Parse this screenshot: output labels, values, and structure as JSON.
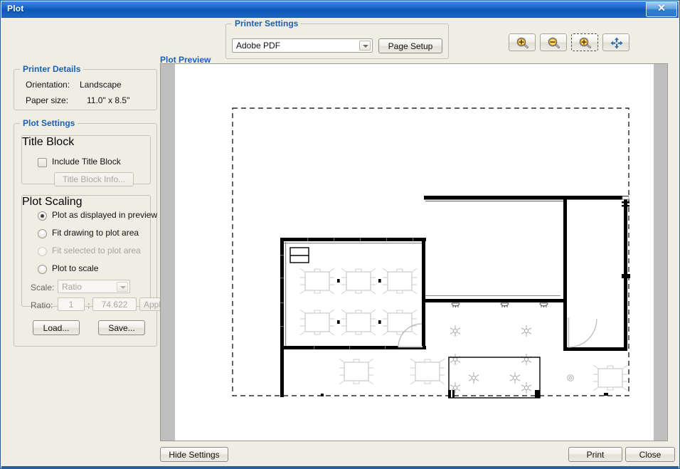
{
  "window": {
    "title": "Plot",
    "close_icon": "close-icon",
    "close_glyph": "✕",
    "accent_color": "#1b5fb4",
    "titlebar_color": "#1665c8",
    "face_color": "#efedE4"
  },
  "printer_details": {
    "legend": "Printer Details",
    "orientation_label": "Orientation:",
    "orientation_value": "Landscape",
    "paper_size_label": "Paper size:",
    "paper_size_value": "11.0\" x 8.5\""
  },
  "plot_settings": {
    "legend": "Plot Settings",
    "title_block": {
      "legend": "Title Block",
      "include_checkbox_label": "Include Title Block",
      "include_checked": false,
      "info_button_label": "Title Block Info...",
      "info_button_enabled": false
    },
    "plot_scaling": {
      "legend": "Plot Scaling",
      "options": [
        {
          "label": "Plot as displayed in preview",
          "selected": true,
          "enabled": true
        },
        {
          "label": "Fit drawing to plot area",
          "selected": false,
          "enabled": true
        },
        {
          "label": "Fit selected to plot area",
          "selected": false,
          "enabled": false
        },
        {
          "label": "Plot to scale",
          "selected": false,
          "enabled": true
        }
      ],
      "scale_label": "Scale:",
      "scale_value": "Ratio",
      "scale_enabled": false,
      "ratio_label": "Ratio:",
      "ratio_numerator": "1",
      "ratio_separator": ":",
      "ratio_denominator": "74.622",
      "apply_button_label": "Apply",
      "apply_enabled": false
    },
    "load_button_label": "Load...",
    "save_button_label": "Save..."
  },
  "printer_settings": {
    "legend": "Printer Settings",
    "printer_selected": "Adobe PDF",
    "printer_dropdown_icon": "chevron-down-icon",
    "page_setup_button_label": "Page Setup"
  },
  "toolbar": {
    "buttons": [
      {
        "name": "zoom-in-icon",
        "tooltip": "Zoom In"
      },
      {
        "name": "zoom-out-icon",
        "tooltip": "Zoom Out"
      },
      {
        "name": "zoom-window-icon",
        "tooltip": "Zoom Window"
      },
      {
        "name": "pan-icon",
        "tooltip": "Pan"
      }
    ]
  },
  "preview": {
    "label": "Plot Preview",
    "page_background": "#ffffff",
    "matte_color": "#bfbfbf",
    "plot_area_border_style": "dashed",
    "drawing_description": "Architectural floor plan: office suite with cubicle workstations, ceiling fixtures and door swings"
  },
  "footer": {
    "hide_settings_label": "Hide Settings",
    "print_label": "Print",
    "close_label": "Close"
  }
}
